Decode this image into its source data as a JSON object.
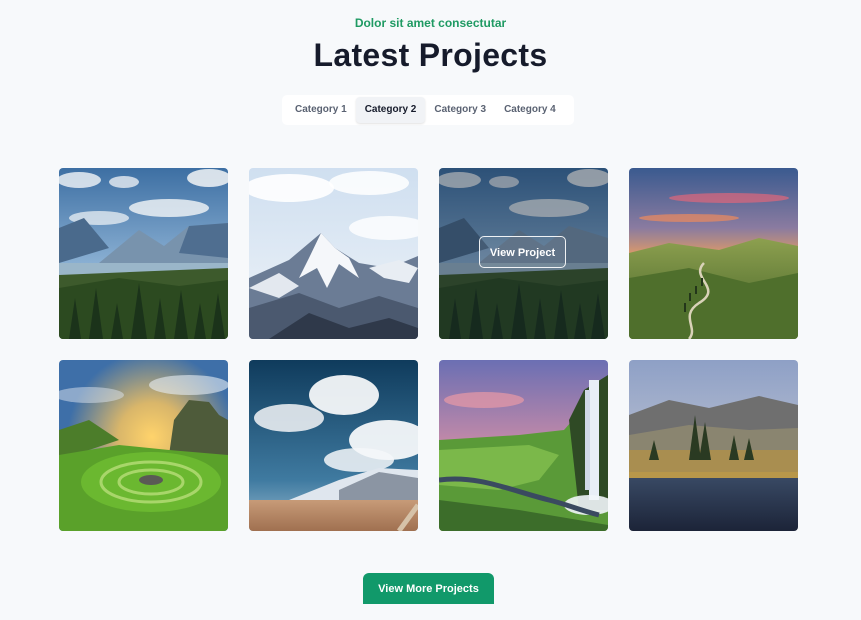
{
  "header": {
    "eyebrow": "Dolor sit amet consectutar",
    "title": "Latest Projects"
  },
  "tabs": [
    {
      "label": "Category 1",
      "active": false
    },
    {
      "label": "Category 2",
      "active": true
    },
    {
      "label": "Category 3",
      "active": false
    },
    {
      "label": "Category 4",
      "active": false
    }
  ],
  "gallery": {
    "items": [
      {
        "subject": "mountain-valley-forest"
      },
      {
        "subject": "snowy-peak"
      },
      {
        "subject": "mountain-valley-forest",
        "hovered": true,
        "overlay_label": "View Project"
      },
      {
        "subject": "sunset-rolling-hills"
      },
      {
        "subject": "green-valley-sunrise-circle"
      },
      {
        "subject": "clouds-desert-snow-mountain"
      },
      {
        "subject": "waterfall-cliff"
      },
      {
        "subject": "lake-trees-misty-hills"
      }
    ]
  },
  "footer": {
    "more_button_label": "View More Projects"
  },
  "colors": {
    "accent": "#1f9a63",
    "button": "#11996a",
    "title": "#161b2b",
    "background": "#f7f9fb"
  }
}
